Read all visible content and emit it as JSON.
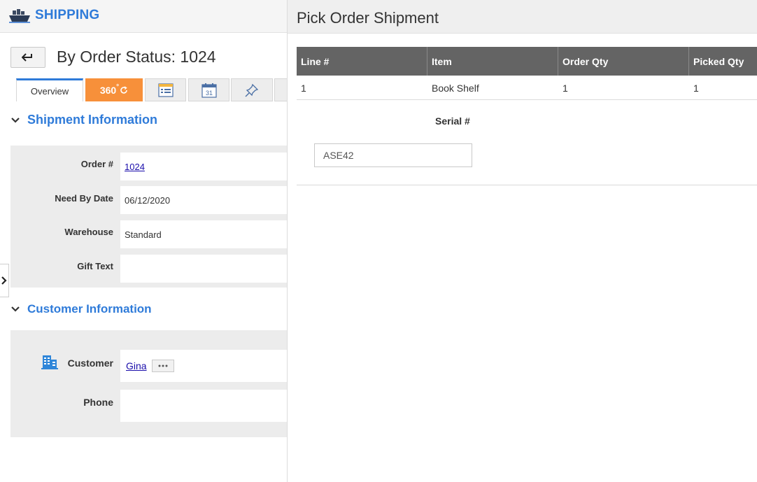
{
  "app": {
    "title": "SHIPPING"
  },
  "record": {
    "title": "By Order Status: 1024"
  },
  "tabs": {
    "overview": "Overview",
    "t360": "360",
    "t360_suffix": "°"
  },
  "shipment_section": {
    "title": "Shipment Information",
    "fields": {
      "order_label": "Order #",
      "order_value": "1024",
      "need_label": "Need By Date",
      "need_value": "06/12/2020",
      "warehouse_label": "Warehouse",
      "warehouse_value": "Standard",
      "gift_label": "Gift Text",
      "gift_value": ""
    }
  },
  "customer_section": {
    "title": "Customer Information",
    "fields": {
      "customer_label": "Customer",
      "customer_value": "Gina",
      "phone_label": "Phone",
      "phone_value": ""
    }
  },
  "calendar_icon_day": "31",
  "panel": {
    "title": "Pick Order Shipment",
    "columns": [
      "Line #",
      "Item",
      "Order Qty",
      "Picked Qty"
    ],
    "rows": [
      [
        "1",
        "Book Shelf",
        "1",
        "1"
      ]
    ],
    "serial_label": "Serial #",
    "serial_value": "ASE42"
  },
  "colors": {
    "accent": "#2f7bd9",
    "tab_360": "#f7903a",
    "grid_header": "#646464"
  }
}
